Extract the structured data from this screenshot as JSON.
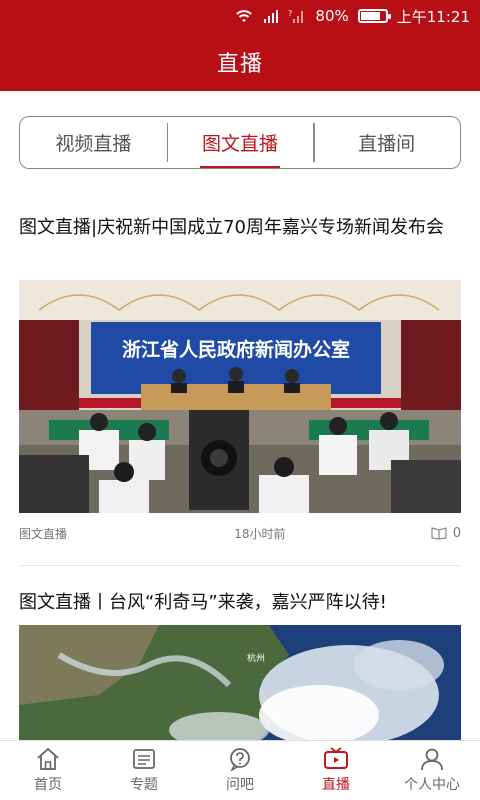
{
  "status_bar": {
    "battery": "80%",
    "time": "上午11:21",
    "battery_level": 0.8
  },
  "header": {
    "title": "直播"
  },
  "tabs": [
    {
      "label": "视频直播",
      "active": false
    },
    {
      "label": "图文直播",
      "active": true
    },
    {
      "label": "直播间",
      "active": false
    }
  ],
  "articles": [
    {
      "title": "图文直播|庆祝新中国成立70周年嘉兴专场新闻发布会",
      "image_banner_text": "浙江省人民政府新闻办公室",
      "tag": "图文直播",
      "time": "18小时前",
      "reads": "0"
    },
    {
      "title": "图文直播丨台风“利奇马”来袭，嘉兴严阵以待!",
      "image_text": "杭州"
    }
  ],
  "bottom_nav": [
    {
      "label": "首页",
      "icon": "home-icon",
      "active": false
    },
    {
      "label": "专题",
      "icon": "topic-icon",
      "active": false
    },
    {
      "label": "问吧",
      "icon": "question-icon",
      "active": false
    },
    {
      "label": "直播",
      "icon": "tv-icon",
      "active": true
    },
    {
      "label": "个人中心",
      "icon": "user-icon",
      "active": false
    }
  ],
  "colors": {
    "brand": "#b80f17",
    "accent": "#c0161e"
  }
}
